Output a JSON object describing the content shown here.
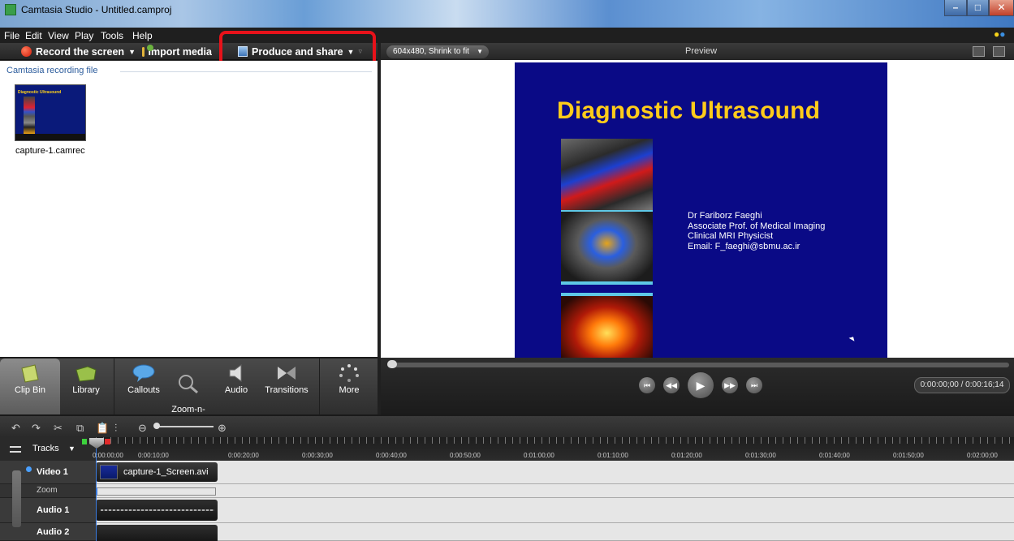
{
  "window": {
    "title": "Camtasia Studio - Untitled.camproj"
  },
  "menu": [
    "File",
    "Edit",
    "View",
    "Play",
    "Tools",
    "Help"
  ],
  "toolbar": {
    "record": "Record the screen",
    "import": "Import media",
    "produce": "Produce and share"
  },
  "clipbin": {
    "group_label": "Camtasia recording file",
    "thumb_title": "Diagnostic Ultrasound",
    "file_name": "capture-1.camrec"
  },
  "tasks": {
    "clip_bin": "Clip Bin",
    "library": "Library",
    "callouts": "Callouts",
    "zoom": "Zoom-n-\nPan",
    "audio": "Audio",
    "transitions": "Transitions",
    "more": "More"
  },
  "preview": {
    "size_option": "604x480, Shrink to fit",
    "label": "Preview",
    "slide_title": "Diagnostic Ultrasound",
    "slide_lines": [
      "Dr Fariborz Faeghi",
      "Associate Prof. of Medical Imaging",
      "Clinical MRI Physicist",
      "Email: F_faeghi@sbmu.ac.ir"
    ]
  },
  "player": {
    "timecode": "0:00:00;00 / 0:00:16;14"
  },
  "timeline": {
    "tracks_label": "Tracks",
    "ruler": [
      "0:00:00;00",
      "0:00:10;00",
      "0:00:20;00",
      "0:00:30;00",
      "0:00:40;00",
      "0:00:50;00",
      "0:01:00;00",
      "0:01:10;00",
      "0:01:20;00",
      "0:01:30;00",
      "0:01:40;00",
      "0:01:50;00",
      "0:02:00;00"
    ],
    "video_track": "Video 1",
    "zoom_track": "Zoom",
    "audio_track": "Audio 1",
    "audio2_track": "Audio 2",
    "video_clip": "capture-1_Screen.avi"
  },
  "colors": {
    "highlight": "#e8121a",
    "slide_bg": "#0a0a86",
    "slide_title": "#ffcc1a"
  }
}
